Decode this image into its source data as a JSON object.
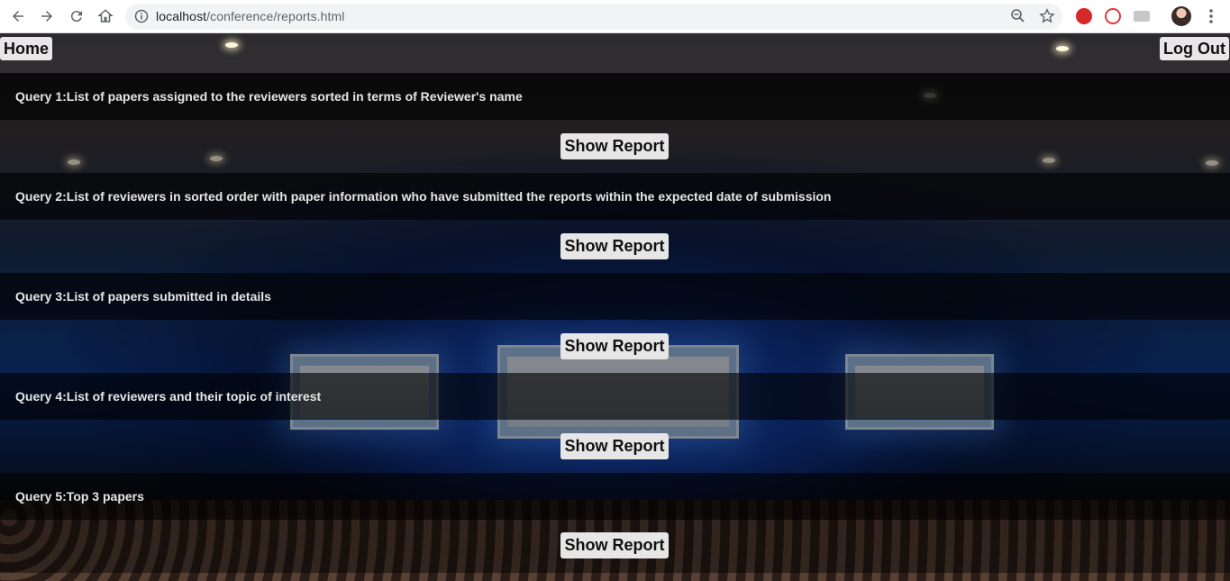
{
  "browser": {
    "url_host": "localhost",
    "url_path": "/conference/reports.html"
  },
  "page": {
    "home_label": "Home",
    "logout_label": "Log Out",
    "queries": [
      {
        "label": "Query 1:List of papers assigned to the reviewers sorted in terms of Reviewer's name",
        "button": "Show Report"
      },
      {
        "label": "Query 2:List of reviewers in sorted order with paper information who have submitted the reports within the expected date of submission",
        "button": "Show Report"
      },
      {
        "label": "Query 3:List of papers submitted in details",
        "button": "Show Report"
      },
      {
        "label": "Query 4:List of reviewers and their topic of interest",
        "button": "Show Report"
      },
      {
        "label": "Query 5:Top 3 papers",
        "button": "Show Report"
      }
    ]
  },
  "icons": {
    "back": "back-arrow-icon",
    "forward": "forward-arrow-icon",
    "reload": "reload-icon",
    "home": "home-icon",
    "info": "info-icon",
    "zoom": "zoom-out-icon",
    "star": "star-icon",
    "menu": "kebab-menu-icon"
  },
  "colors": {
    "query_band": "#000000",
    "button_bg": "#e6e6e6",
    "query_text": "#e6e6e6"
  }
}
